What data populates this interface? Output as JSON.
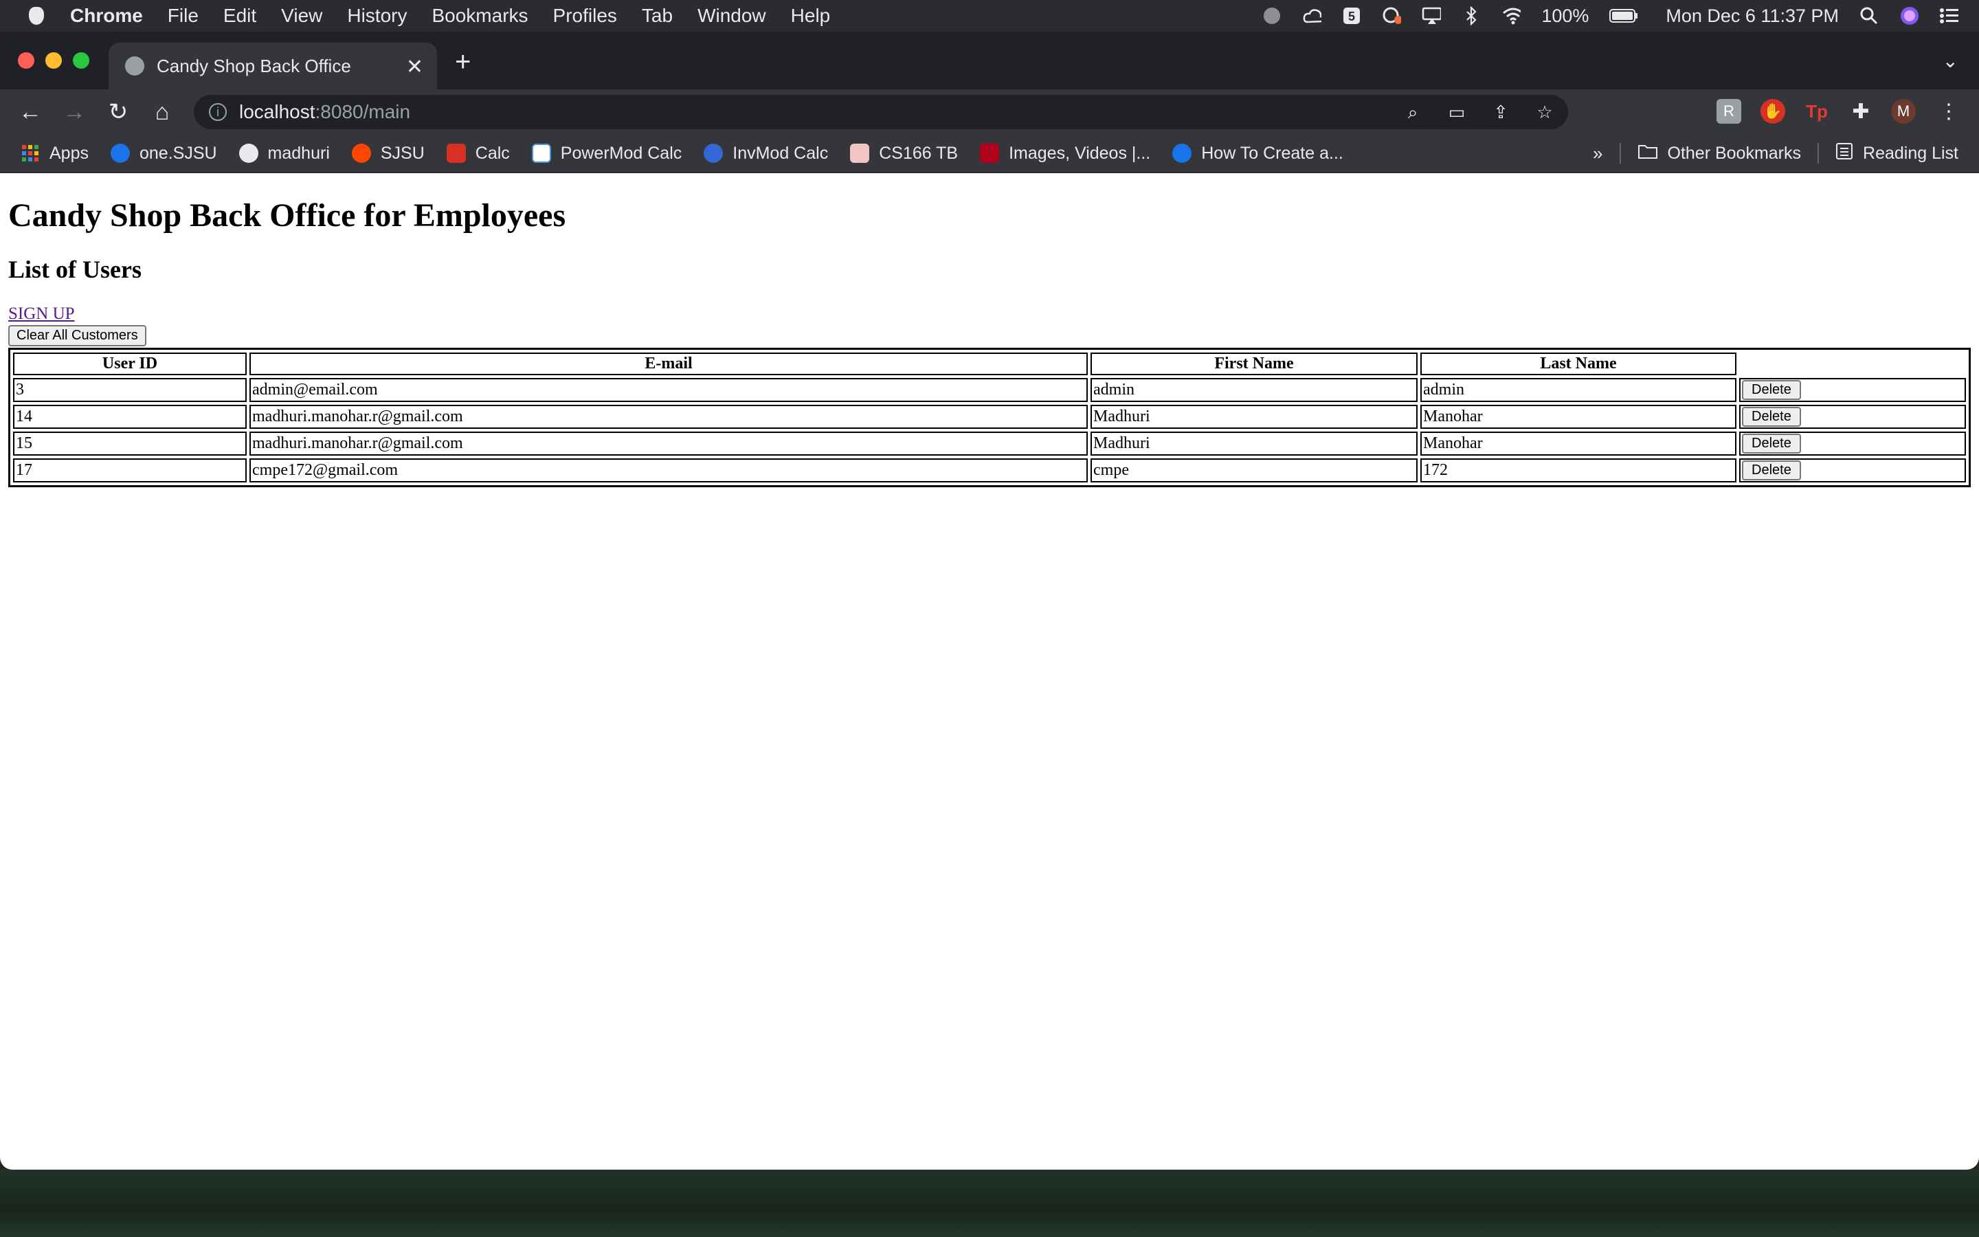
{
  "menubar": {
    "app": "Chrome",
    "items": [
      "File",
      "Edit",
      "View",
      "History",
      "Bookmarks",
      "Profiles",
      "Tab",
      "Window",
      "Help"
    ],
    "battery": "100%",
    "clock": "Mon Dec 6  11:37 PM"
  },
  "browser": {
    "tab_title": "Candy Shop Back Office",
    "url_host": "localhost",
    "url_path": ":8080/main",
    "profile_initial": "M",
    "bookmarks": [
      {
        "label": "Apps",
        "color": "#ea4335"
      },
      {
        "label": "one.SJSU",
        "color": "#1a73e8"
      },
      {
        "label": "madhuri",
        "color": "#ffffff"
      },
      {
        "label": "SJSU",
        "color": "#ff4500"
      },
      {
        "label": "Calc",
        "color": "#d93025"
      },
      {
        "label": "PowerMod Calc",
        "color": "#4a90d9"
      },
      {
        "label": "InvMod Calc",
        "color": "#3367d6"
      },
      {
        "label": "CS166 TB",
        "color": "#f2c4c4"
      },
      {
        "label": "Images, Videos |...",
        "color": "#b3001b"
      },
      {
        "label": "How To Create a...",
        "color": "#1a73e8"
      }
    ],
    "other_bookmarks": "Other Bookmarks",
    "reading_list": "Reading List"
  },
  "page": {
    "title": "Candy Shop Back Office for Employees",
    "subtitle": "List of Users",
    "signup_link": "SIGN UP",
    "clear_button": "Clear All Customers",
    "table": {
      "headers": [
        "User ID",
        "E-mail",
        "First Name",
        "Last Name",
        ""
      ],
      "rows": [
        {
          "id": "3",
          "email": "admin@email.com",
          "first": "admin",
          "last": "admin"
        },
        {
          "id": "14",
          "email": "madhuri.manohar.r@gmail.com",
          "first": "Madhuri",
          "last": "Manohar"
        },
        {
          "id": "15",
          "email": "madhuri.manohar.r@gmail.com",
          "first": "Madhuri",
          "last": "Manohar"
        },
        {
          "id": "17",
          "email": "cmpe172@gmail.com",
          "first": "cmpe",
          "last": "172"
        }
      ],
      "delete_label": "Delete"
    }
  }
}
